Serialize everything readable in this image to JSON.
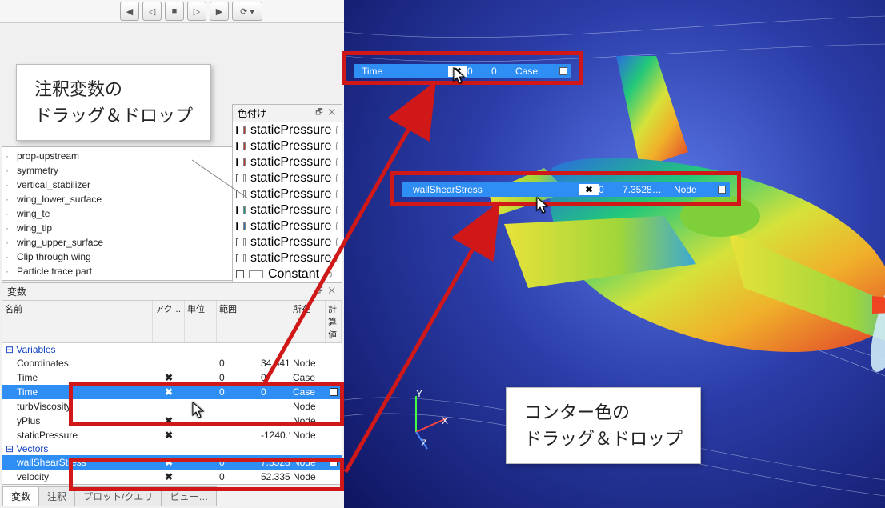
{
  "toolbar": {
    "buttons": [
      "◀",
      "◁",
      "■",
      "▷",
      "▶",
      "⟳ ▾"
    ]
  },
  "colorPanel": {
    "title": "色付け",
    "rows": [
      {
        "c": "#c83232",
        "label": "staticPressure"
      },
      {
        "c": "#c83232",
        "label": "staticPressure"
      },
      {
        "c": "#c83232",
        "label": "staticPressure"
      },
      {
        "c": "#ffffff",
        "label": "staticPressure",
        "checked": false
      },
      {
        "c": "#ffffff",
        "label": "staticPressure",
        "checked": false
      },
      {
        "c": "#159f86",
        "label": "staticPressure"
      },
      {
        "c": "#2f6fb0",
        "label": "staticPressure"
      },
      {
        "c": "#ffffff",
        "label": "staticPressure",
        "checked": false
      },
      {
        "c": "#ffffff",
        "label": "staticPressure",
        "checked": false
      },
      {
        "c": "#ffffff",
        "label": "Constant",
        "checked": false
      }
    ]
  },
  "parts": [
    {
      "name": "prop-upstream",
      "id": ""
    },
    {
      "name": "symmetry",
      "id": "10"
    },
    {
      "name": "vertical_stabilizer",
      "id": "11",
      "x": true
    },
    {
      "name": "wing_lower_surface",
      "id": "12",
      "x": true
    },
    {
      "name": "wing_te",
      "id": "13",
      "x": true
    },
    {
      "name": "wing_tip",
      "id": "14",
      "x": true
    },
    {
      "name": "wing_upper_surface",
      "id": "15",
      "x": true
    },
    {
      "name": "Clip through wing",
      "id": "16",
      "x": true
    },
    {
      "name": "Particle trace part",
      "id": "17"
    }
  ],
  "varsPanel": {
    "title": "変数",
    "headers": [
      "名前",
      "アク…",
      "単位",
      "範囲",
      "",
      "所在",
      "計算値"
    ],
    "groups": [
      {
        "label": "Variables",
        "rows": [
          {
            "name": "Coordinates",
            "min": "0",
            "max": "34.641",
            "loc": "Node"
          },
          {
            "name": "Time",
            "x": true,
            "min": "0",
            "max": "0",
            "loc": "Case"
          },
          {
            "name": "Time",
            "x": true,
            "min": "0",
            "max": "0",
            "loc": "Case",
            "sel": true,
            "chk": true
          },
          {
            "name": "turbViscosity",
            "loc": "Node"
          },
          {
            "name": "yPlus",
            "x": true,
            "loc": "Node"
          },
          {
            "name": "staticPressure",
            "x": true,
            "min": "",
            "max": "-1240.16 …",
            "loc": "Node"
          }
        ]
      },
      {
        "label": "Vectors",
        "rows": [
          {
            "name": "wallShearStress",
            "x": true,
            "min": "0",
            "max": "7.3528…",
            "loc": "Node",
            "sel": true,
            "chk": true
          },
          {
            "name": "velocity",
            "x": true,
            "min": "0",
            "max": "52.335…",
            "loc": "Node"
          }
        ]
      }
    ],
    "tabs": [
      "変数",
      "注釈",
      "プロット/クエリ",
      "ビュー…"
    ]
  },
  "viewport": {
    "dragTime": {
      "label": "Time",
      "min": "0",
      "max": "0",
      "loc": "Case"
    },
    "dragWSS": {
      "label": "wallShearStress",
      "min": "0",
      "max": "7.3528…",
      "loc": "Node"
    },
    "axis": {
      "x": "X",
      "y": "Y",
      "z": "Z"
    }
  },
  "callouts": {
    "left": "注釈変数の\nドラッグ＆ドロップ",
    "right": "コンター色の\nドラッグ＆ドロップ"
  }
}
